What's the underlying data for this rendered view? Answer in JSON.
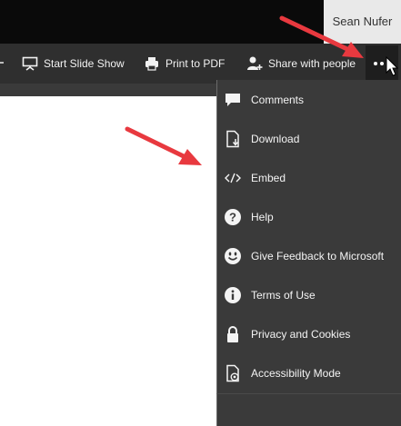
{
  "header": {
    "user_name": "Sean Nufer"
  },
  "toolbar": {
    "start_slide_show": "Start Slide Show",
    "print_to_pdf": "Print to PDF",
    "share_with_people": "Share with people"
  },
  "menu": {
    "items": [
      {
        "label": "Comments",
        "icon": "comment-icon"
      },
      {
        "label": "Download",
        "icon": "download-icon"
      },
      {
        "label": "Embed",
        "icon": "embed-icon"
      },
      {
        "label": "Help",
        "icon": "help-icon"
      },
      {
        "label": "Give Feedback to Microsoft",
        "icon": "smiley-icon"
      },
      {
        "label": "Terms of Use",
        "icon": "info-icon"
      },
      {
        "label": "Privacy and Cookies",
        "icon": "lock-icon"
      },
      {
        "label": "Accessibility Mode",
        "icon": "accessibility-document-icon"
      }
    ]
  },
  "colors": {
    "toolbar_bg": "#2f2f2f",
    "menu_bg": "#3a3a3a",
    "text": "#f4f4f4",
    "annotation_arrow": "#e8393f"
  }
}
